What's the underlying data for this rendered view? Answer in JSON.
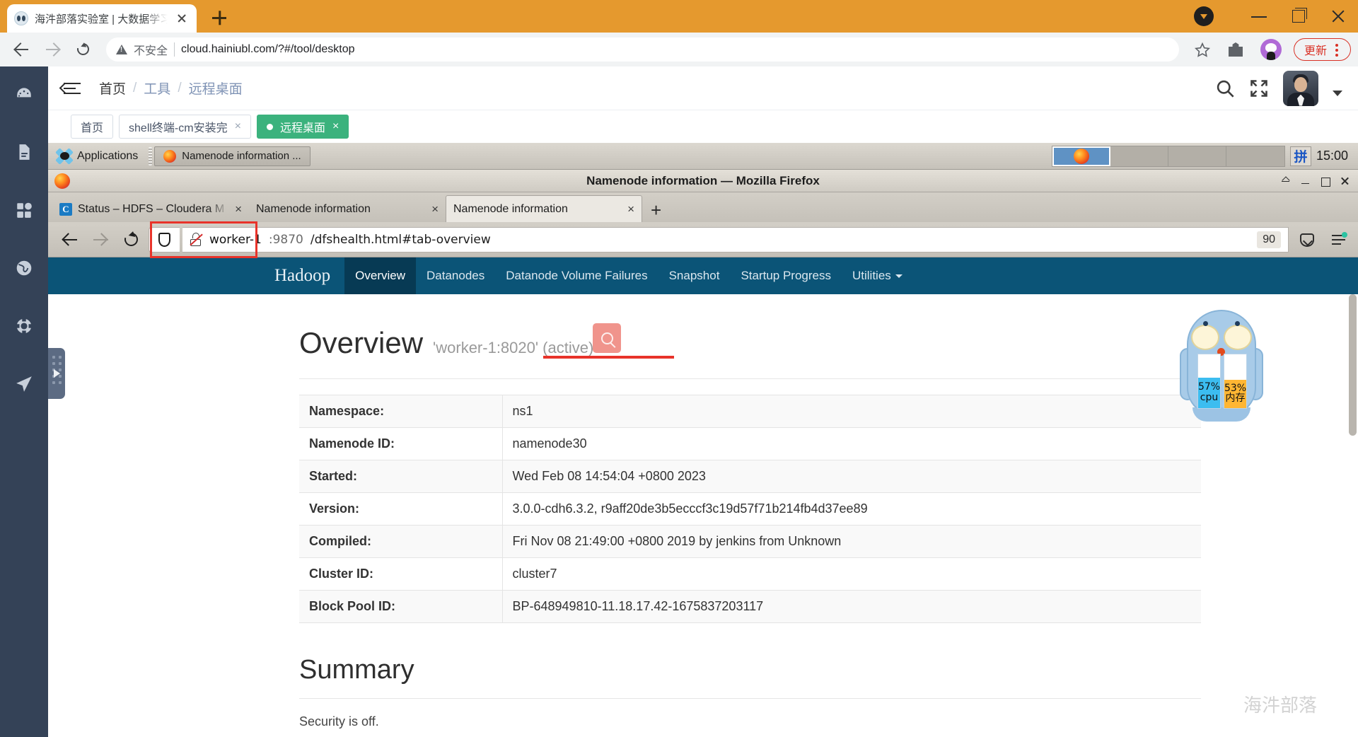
{
  "chrome": {
    "tab": {
      "title": "海汼部落实验室 | 大数据学习云环",
      "favicon": "panda-favicon",
      "close": "×"
    },
    "new_tab": "+",
    "nav": {
      "back": "back-arrow",
      "forward": "forward-arrow",
      "reload": "reload-icon"
    },
    "omnibox": {
      "warning_icon": "warning-triangle-icon",
      "insecure_label": "不安全",
      "url": "cloud.hainiubl.com/?#/tool/desktop"
    },
    "toolbar": {
      "bookmark": "star-icon",
      "extensions": "puzzle-icon",
      "profile": "panda-avatar",
      "update_label": "更新",
      "menu": "kebab-menu-icon"
    },
    "window": {
      "minimize": "−",
      "maximize": "□",
      "close": "×"
    }
  },
  "app": {
    "sidebar": [
      {
        "name": "dashboard",
        "icon": "gauge-icon"
      },
      {
        "name": "documents",
        "icon": "document-icon"
      },
      {
        "name": "apps",
        "icon": "grid-icon"
      },
      {
        "name": "network",
        "icon": "globe-icon"
      },
      {
        "name": "support",
        "icon": "target-icon"
      },
      {
        "name": "messages",
        "icon": "paper-plane-icon"
      }
    ],
    "header": {
      "menu_toggle": "collapse-menu-icon",
      "breadcrumb": [
        "首页",
        "工具",
        "远程桌面"
      ],
      "separator": "/",
      "search_icon": "search-icon",
      "fullscreen_icon": "fullscreen-icon",
      "avatar": "user-avatar",
      "caret": "chevron-down-icon"
    },
    "tabs": [
      {
        "label": "首页",
        "active": false,
        "closable": false
      },
      {
        "label": "shell终端-cm安装完",
        "active": false,
        "closable": true
      },
      {
        "label": "远程桌面",
        "active": true,
        "closable": true
      }
    ],
    "tab_close_glyph": "×",
    "panel_handle": "sidebar-drag-handle"
  },
  "desktop": {
    "panel": {
      "applications": "Applications",
      "window_button": "Namenode information ...",
      "workspaces": 4,
      "active_workspace": 1,
      "ime": "拼",
      "clock": "15:00"
    },
    "firefox": {
      "title": "Namenode information — Mozilla Firefox",
      "tabs": [
        {
          "label": "Status – HDFS – Cloudera M",
          "favicon": "cloudera-icon",
          "selected": false
        },
        {
          "label": "Namenode information",
          "favicon": "",
          "selected": false
        },
        {
          "label": "Namenode information",
          "favicon": "",
          "selected": true
        }
      ],
      "tab_close": "×",
      "new_tab": "+",
      "nav": {
        "back": "back-arrow",
        "forward": "forward-arrow",
        "reload": "reload-icon"
      },
      "urlbar": {
        "security_icon": "broken-lock-icon",
        "host": "worker-1",
        "port": ":9870",
        "path": "/dfshealth.html#tab-overview",
        "zoom": "90",
        "pocket": "pocket-icon",
        "menu": "hamburger-menu-icon"
      },
      "window_controls": {
        "shade": "▲",
        "minimize": "−",
        "maximize": "□",
        "close": "×"
      }
    },
    "monitor_widget": {
      "cpu_value": "57%",
      "cpu_label": "cpu",
      "cpu_percent": 57,
      "mem_value": "53%",
      "mem_label": "内存",
      "mem_percent": 53
    },
    "hadoop": {
      "brand": "Hadoop",
      "nav": [
        {
          "label": "Overview",
          "active": true
        },
        {
          "label": "Datanodes",
          "active": false
        },
        {
          "label": "Datanode Volume Failures",
          "active": false
        },
        {
          "label": "Snapshot",
          "active": false
        },
        {
          "label": "Startup Progress",
          "active": false
        },
        {
          "label": "Utilities",
          "active": false,
          "dropdown": true
        }
      ],
      "overview_title": "Overview",
      "overview_subtitle": "'worker-1:8020' (active)",
      "info_rows": [
        {
          "key": "Namespace:",
          "value": "ns1"
        },
        {
          "key": "Namenode ID:",
          "value": "namenode30"
        },
        {
          "key": "Started:",
          "value": "Wed Feb 08 14:54:04 +0800 2023"
        },
        {
          "key": "Version:",
          "value": "3.0.0-cdh6.3.2, r9aff20de3b5ecccf3c19d57f71b214fb4d37ee89"
        },
        {
          "key": "Compiled:",
          "value": "Fri Nov 08 21:49:00 +0800 2019 by jenkins from Unknown"
        },
        {
          "key": "Cluster ID:",
          "value": "cluster7"
        },
        {
          "key": "Block Pool ID:",
          "value": "BP-648949810-11.18.17.42-1675837203117"
        }
      ],
      "summary_title": "Summary",
      "summary_text": "Security is off."
    },
    "watermark": "海汼部落"
  },
  "colors": {
    "chrome_accent": "#e5992e",
    "app_sidebar": "#344257",
    "tab_active": "#3bb27d",
    "hadoop_nav": "#0b5477",
    "hadoop_nav_active": "#073a54",
    "annotation_red": "#e8332a",
    "cpu_blue": "#3cbdf0",
    "mem_orange": "#ffb633"
  }
}
